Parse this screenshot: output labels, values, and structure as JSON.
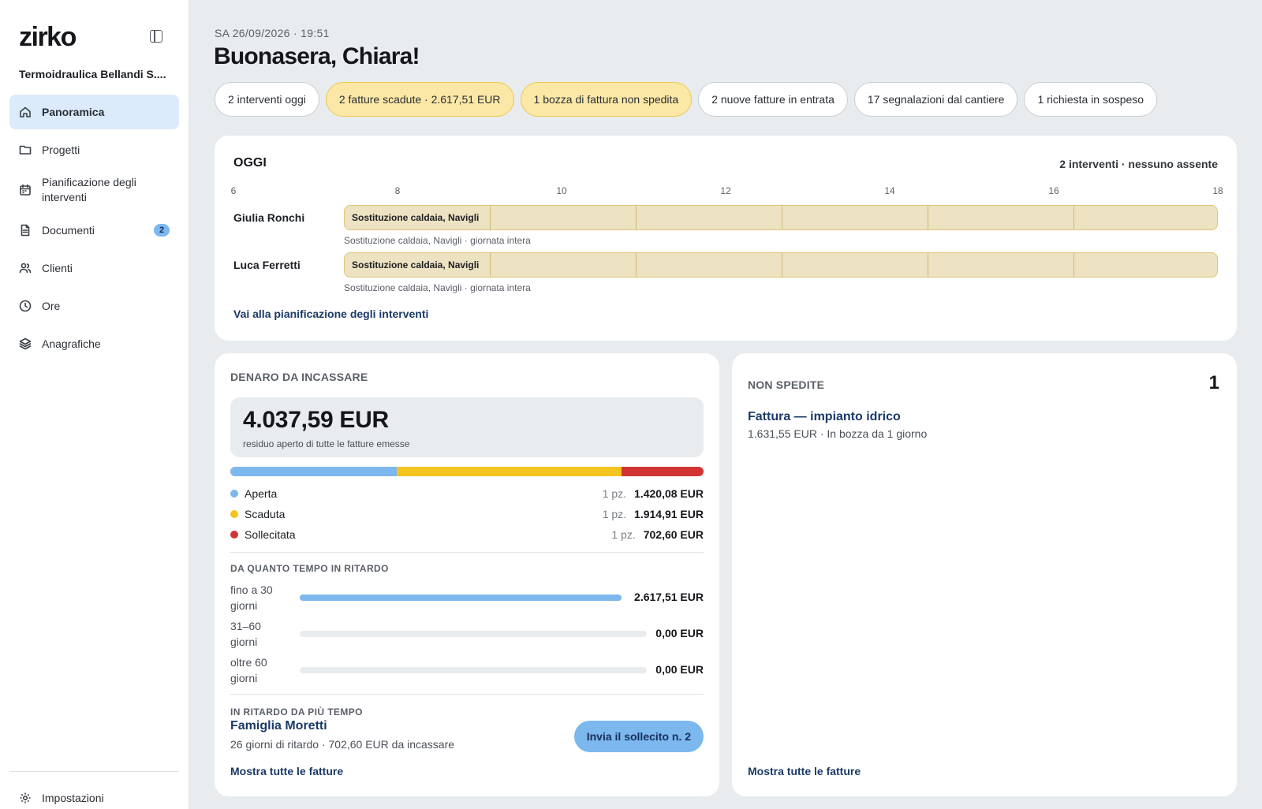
{
  "sidebar": {
    "logo": "zirko",
    "company": "Termoidraulica Bellandi S....",
    "items": [
      {
        "label": "Panoramica"
      },
      {
        "label": "Progetti"
      },
      {
        "label": "Pianificazione degli interventi"
      },
      {
        "label": "Documenti",
        "badge": "2"
      },
      {
        "label": "Clienti"
      },
      {
        "label": "Ore"
      },
      {
        "label": "Anagrafiche"
      }
    ],
    "settings_label": "Impostazioni"
  },
  "header": {
    "date": "SA 26/09/2026 · 19:51",
    "greeting": "Buonasera, Chiara!"
  },
  "chips": [
    {
      "label": "2 interventi oggi",
      "variant": "default"
    },
    {
      "label": "2 fatture scadute · 2.617,51 EUR",
      "variant": "warn"
    },
    {
      "label": "1 bozza di fattura non spedita",
      "variant": "warn"
    },
    {
      "label": "2 nuove fatture in entrata",
      "variant": "default"
    },
    {
      "label": "17 segnalazioni dal cantiere",
      "variant": "default"
    },
    {
      "label": "1 richiesta in sospeso",
      "variant": "default"
    }
  ],
  "today": {
    "title": "OGGI",
    "summary": "2 interventi · nessuno assente",
    "hours": [
      "6",
      "8",
      "10",
      "12",
      "14",
      "16",
      "18"
    ],
    "rows": [
      {
        "name": "Giulia Ronchi",
        "bar_label": "Sostituzione caldaia, Navigli",
        "note": "Sostituzione caldaia, Navigli · giornata intera"
      },
      {
        "name": "Luca Ferretti",
        "bar_label": "Sostituzione caldaia, Navigli",
        "note": "Sostituzione caldaia, Navigli · giornata intera"
      }
    ],
    "link": "Vai alla pianificazione degli interventi"
  },
  "money": {
    "title": "DENARO DA INCASSARE",
    "total": "4.037,59 EUR",
    "total_sub": "residuo aperto di tutte le fatture emesse",
    "breakdown": [
      {
        "label": "Aperta",
        "qty": "1 pz.",
        "value": "1.420,08 EUR",
        "amount": 1420.08,
        "color": "#7cb7ee"
      },
      {
        "label": "Scaduta",
        "qty": "1 pz.",
        "value": "1.914,91 EUR",
        "amount": 1914.91,
        "color": "#f4c51f"
      },
      {
        "label": "Sollecitata",
        "qty": "1 pz.",
        "value": "702,60 EUR",
        "amount": 702.6,
        "color": "#d23434"
      }
    ],
    "aging_title": "DA QUANTO TEMPO IN RITARDO",
    "aging": [
      {
        "label": "fino a 30 giorni",
        "value": "2.617,51 EUR",
        "fraction": 1.0
      },
      {
        "label": "31–60 giorni",
        "value": "0,00 EUR",
        "fraction": 0.0
      },
      {
        "label": "oltre 60 giorni",
        "value": "0,00 EUR",
        "fraction": 0.0
      }
    ],
    "late_title": "IN RITARDO DA PIÙ TEMPO",
    "late_name": "Famiglia Moretti",
    "late_meta": "26 giorni di ritardo · 702,60 EUR da incassare",
    "remind_label": "Invia il sollecito n. 2",
    "link": "Mostra tutte le fatture"
  },
  "unsent": {
    "title": "NON SPEDITE",
    "count": "1",
    "invoice_title": "Fattura — impianto idrico",
    "invoice_meta": "1.631,55 EUR · In bozza da 1 giorno",
    "link": "Mostra tutte le fatture"
  }
}
